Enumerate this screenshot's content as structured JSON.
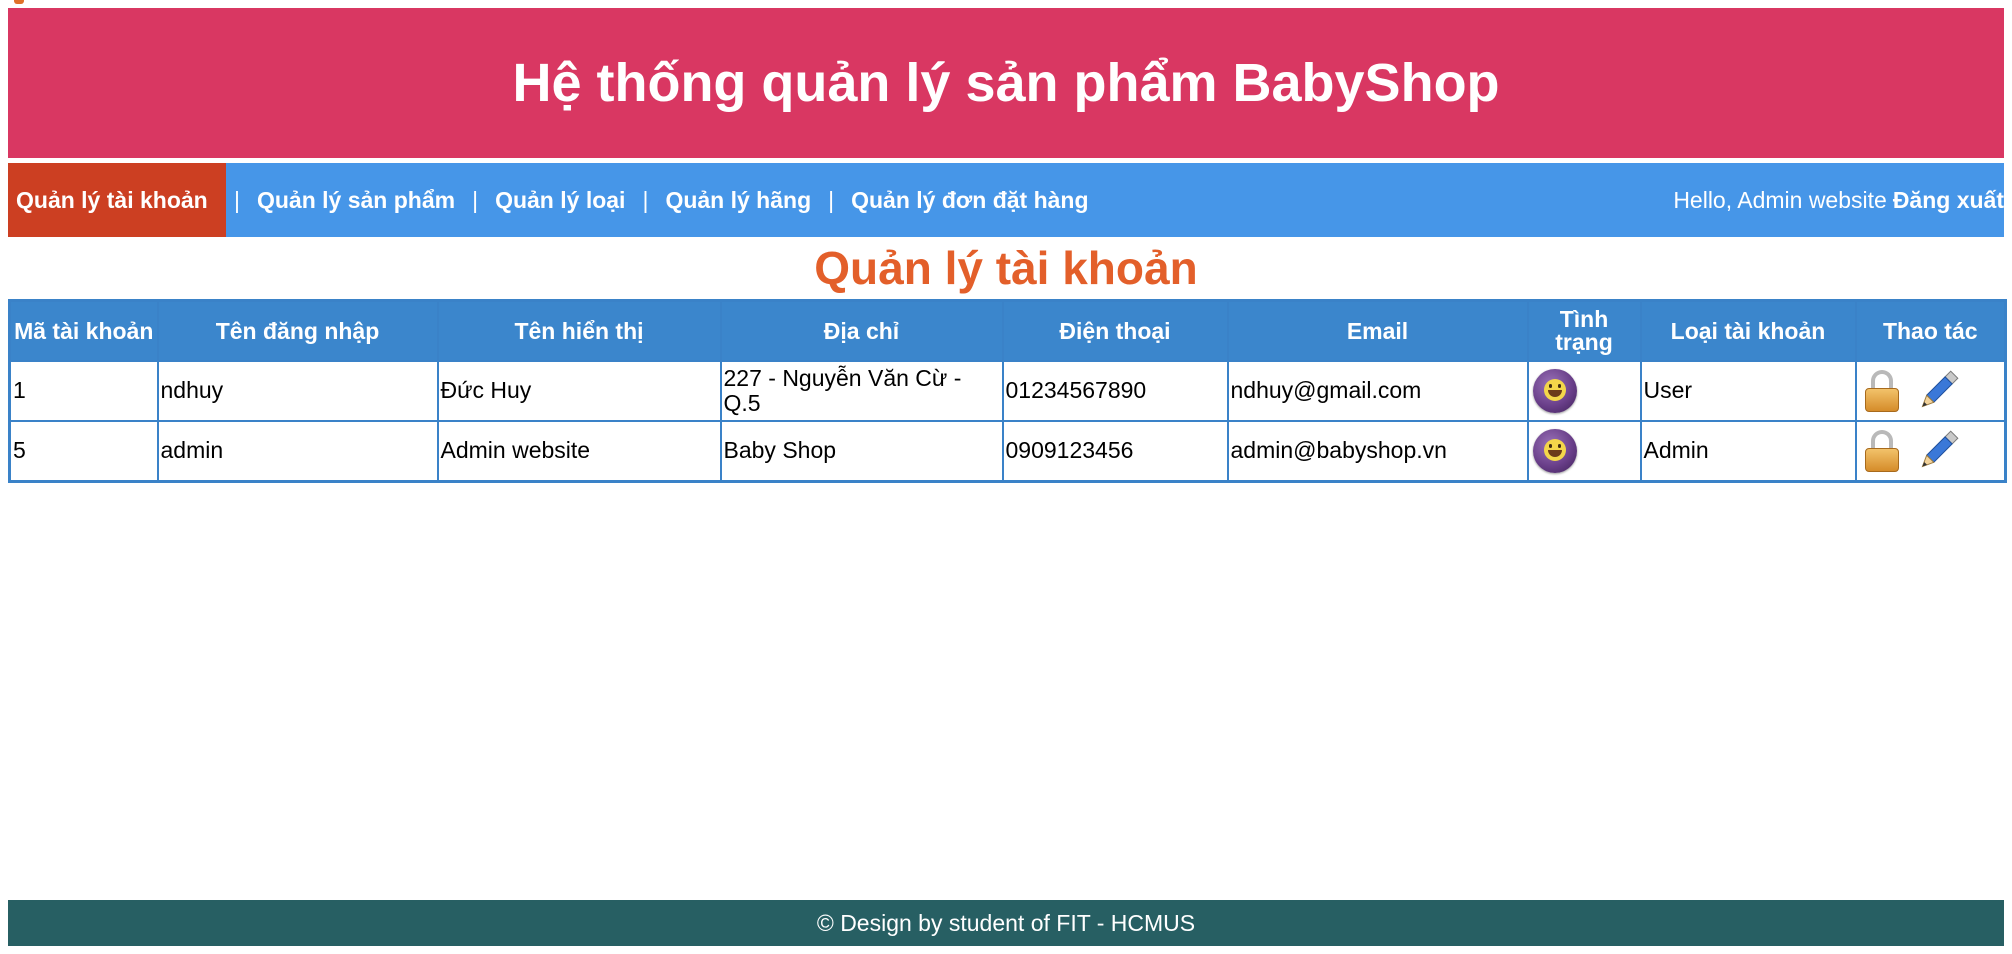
{
  "header": {
    "title": "Hệ thống quản lý sản phẩm BabyShop"
  },
  "nav": {
    "items": [
      {
        "label": "Quản lý tài khoản",
        "active": true
      },
      {
        "label": "Quản lý sản phẩm",
        "active": false
      },
      {
        "label": "Quản lý loại",
        "active": false
      },
      {
        "label": "Quản lý hãng",
        "active": false
      },
      {
        "label": "Quản lý đơn đặt hàng",
        "active": false
      }
    ],
    "separator": "|",
    "greeting": "Hello, Admin website",
    "logout_label": "Đăng xuất"
  },
  "page_title": "Quản lý tài khoản",
  "table": {
    "headers": [
      "Mã tài khoản",
      "Tên đăng nhập",
      "Tên hiển thị",
      "Địa chỉ",
      "Điện thoại",
      "Email",
      "Tình trạng",
      "Loại tài khoản",
      "Thao tác"
    ],
    "rows": [
      {
        "id": "1",
        "username": "ndhuy",
        "display_name": "Đức Huy",
        "address": "227 - Nguyễn Văn Cừ - Q.5",
        "phone": "01234567890",
        "email": "ndhuy@gmail.com",
        "status_icon": "smiley-icon",
        "account_type": "User"
      },
      {
        "id": "5",
        "username": "admin",
        "display_name": "Admin website",
        "address": "Baby Shop",
        "phone": "0909123456",
        "email": "admin@babyshop.vn",
        "status_icon": "smiley-icon",
        "account_type": "Admin"
      }
    ]
  },
  "footer": {
    "text": "© Design by student of FIT - HCMUS"
  },
  "colors": {
    "header_bg": "#d93762",
    "nav_bg": "#4696e8",
    "nav_active_bg": "#cc3f22",
    "page_title": "#e35f2a",
    "table_header_bg": "#3b86cc",
    "footer_bg": "#275f63"
  }
}
